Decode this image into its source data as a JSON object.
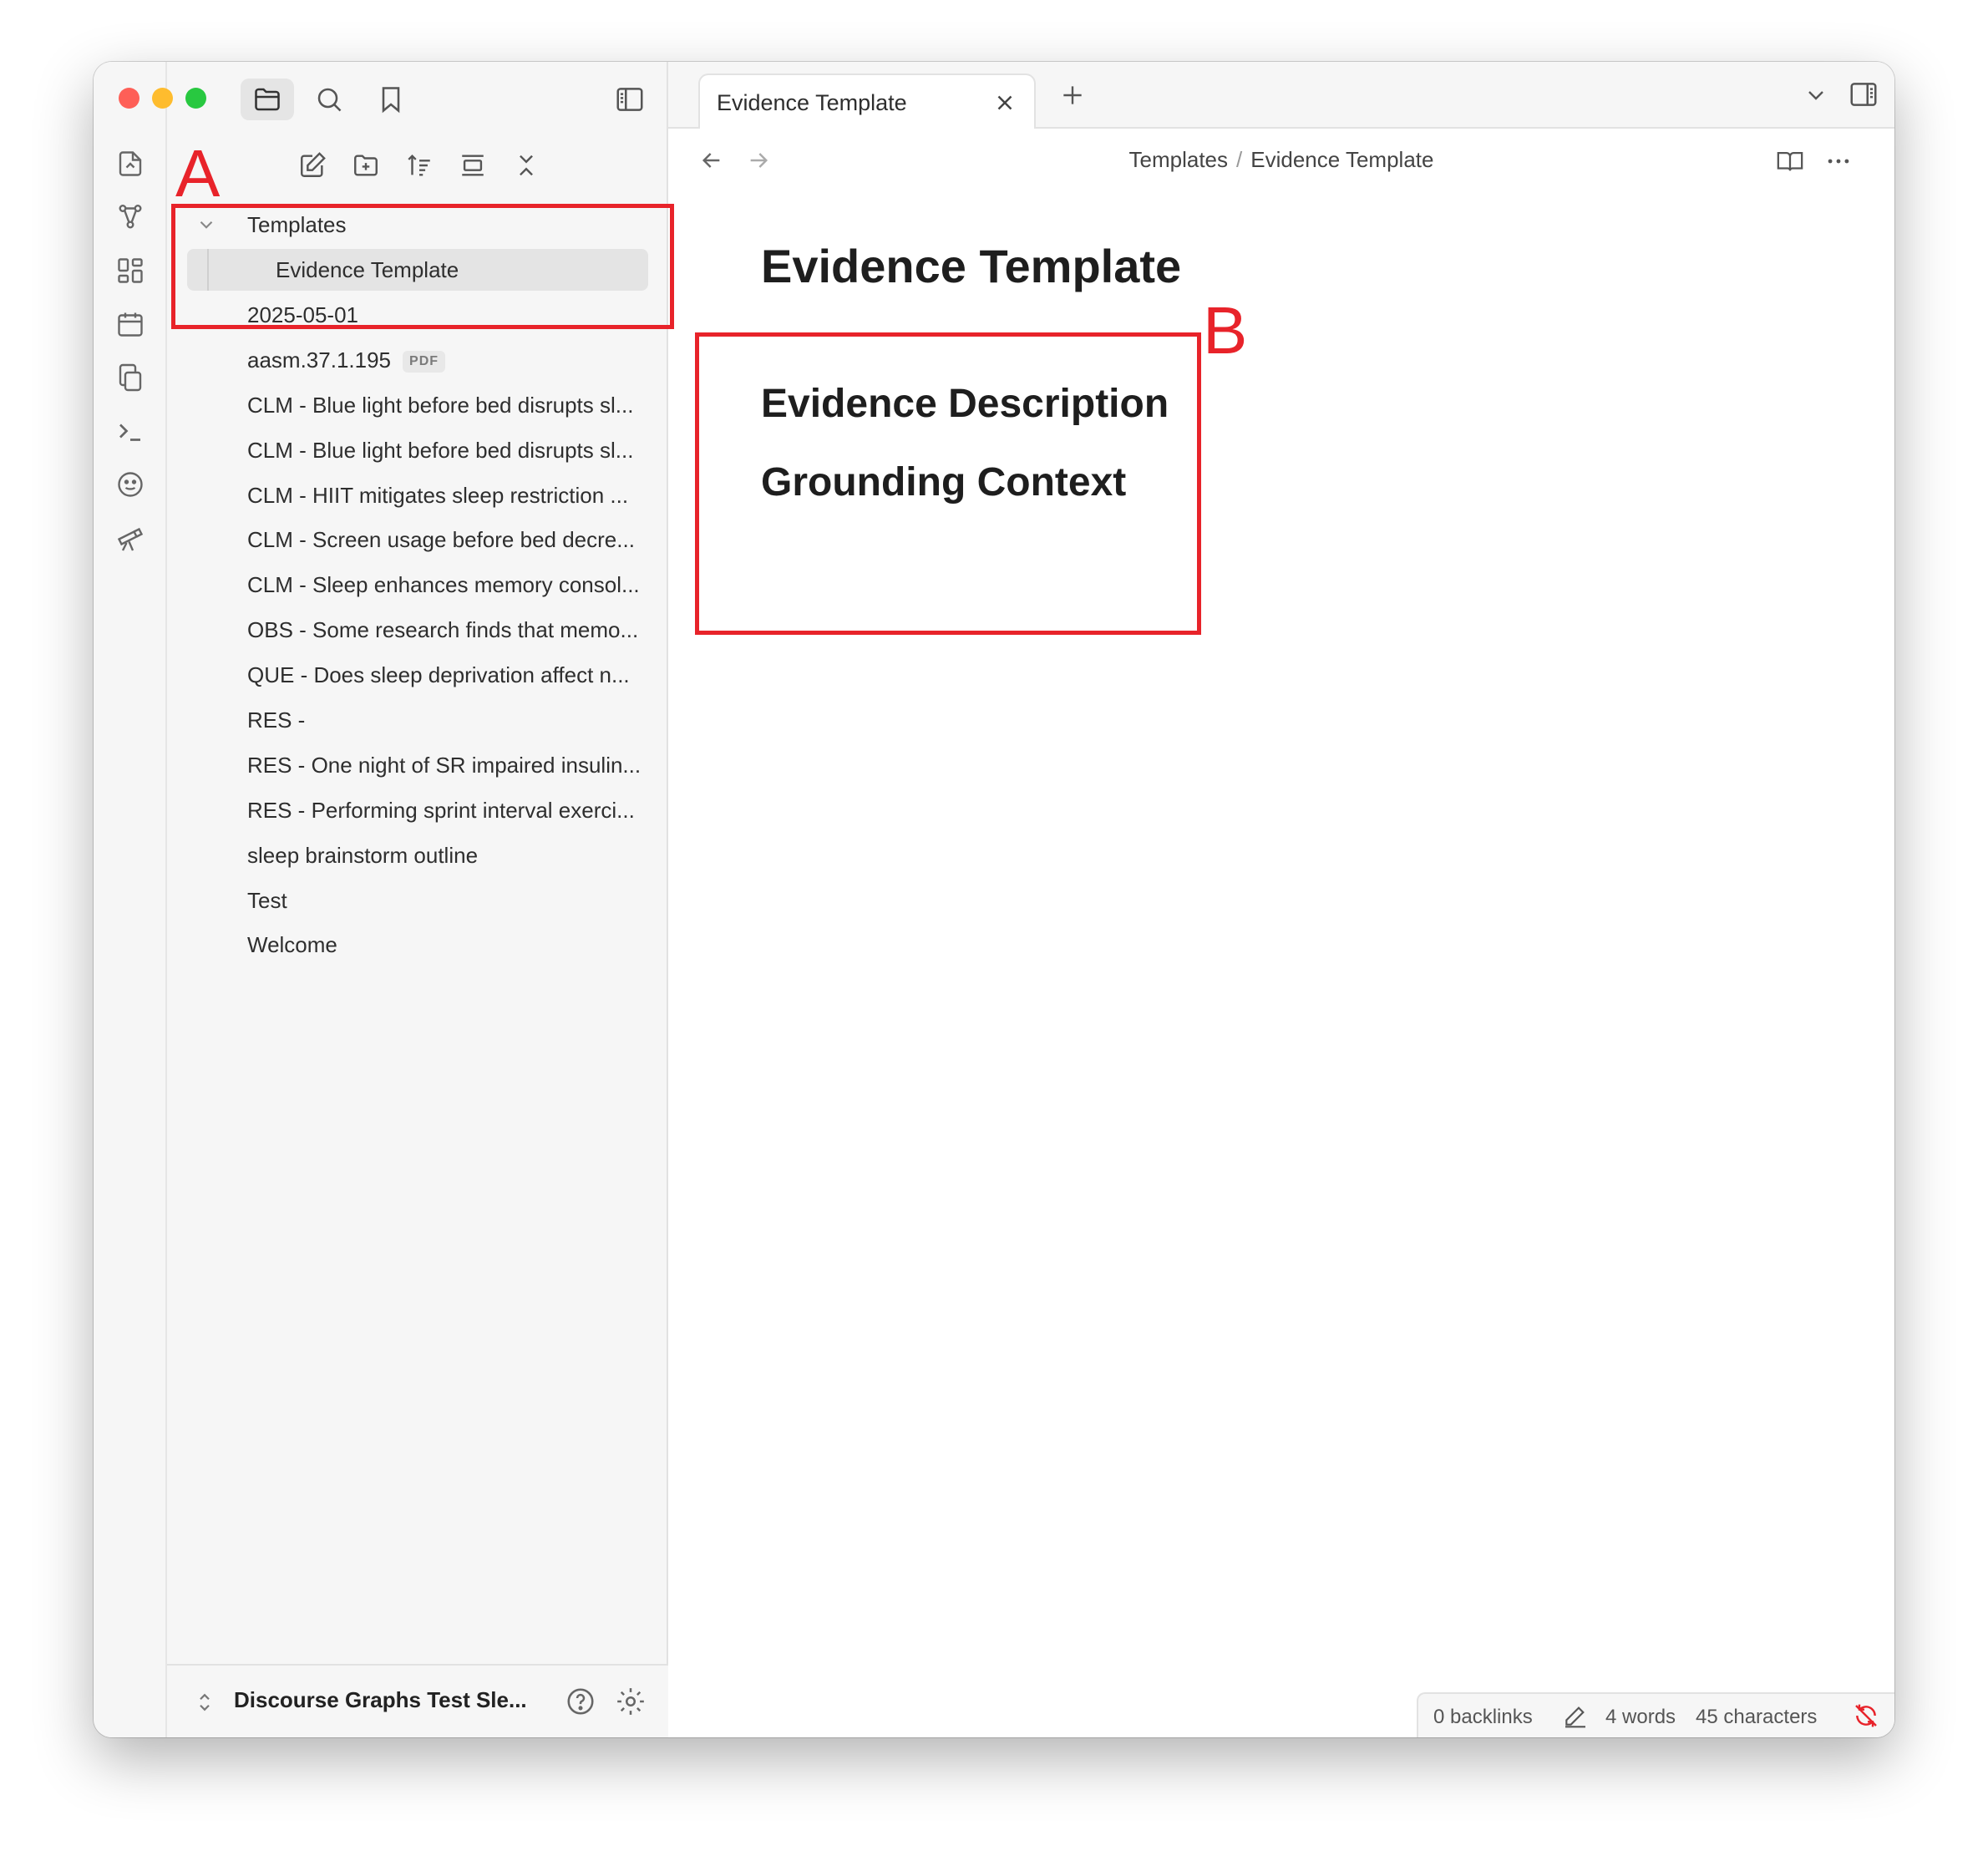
{
  "window": {
    "traffic_lights": {
      "close": "#fe5f57",
      "minimize": "#febc2e",
      "zoom": "#28c840"
    }
  },
  "ribbon": {
    "icons": [
      "switcher-icon",
      "graph-icon",
      "canvas-icon",
      "daily-note-icon",
      "templates-icon",
      "command-palette-icon",
      "face-icon",
      "telescope-icon"
    ]
  },
  "sidebar": {
    "top_icons": [
      "folder-icon",
      "search-icon",
      "bookmark-icon"
    ],
    "actions": [
      "new-note-icon",
      "new-folder-icon",
      "sort-icon",
      "collapse-icon",
      "close-icon"
    ],
    "tree": [
      {
        "label": "Templates",
        "type": "folder"
      },
      {
        "label": "Evidence Template",
        "type": "file",
        "selected": true
      },
      {
        "label": "2025-05-01",
        "type": "file"
      },
      {
        "label": "aasm.37.1.195",
        "type": "file",
        "badge": "PDF"
      },
      {
        "label": "CLM - Blue light before bed disrupts sl...",
        "type": "file"
      },
      {
        "label": "CLM - Blue light before bed disrupts sl...",
        "type": "file"
      },
      {
        "label": "CLM - HIIT mitigates sleep restriction ...",
        "type": "file"
      },
      {
        "label": "CLM - Screen usage before bed decre...",
        "type": "file"
      },
      {
        "label": "CLM - Sleep enhances memory consol...",
        "type": "file"
      },
      {
        "label": "OBS - Some research finds that memo...",
        "type": "file"
      },
      {
        "label": "QUE - Does sleep deprivation affect n...",
        "type": "file"
      },
      {
        "label": "RES -",
        "type": "file"
      },
      {
        "label": "RES - One night of SR impaired insulin...",
        "type": "file"
      },
      {
        "label": "RES - Performing sprint interval exerci...",
        "type": "file"
      },
      {
        "label": "sleep brainstorm outline",
        "type": "file"
      },
      {
        "label": "Test",
        "type": "file"
      },
      {
        "label": "Welcome",
        "type": "file"
      }
    ],
    "vault_name": "Discourse Graphs Test Sle..."
  },
  "tabs": [
    {
      "label": "Evidence Template",
      "active": true
    }
  ],
  "breadcrumb": {
    "folder": "Templates",
    "separator": "/",
    "note": "Evidence Template"
  },
  "note": {
    "title": "Evidence Template",
    "headings": [
      "Evidence Description",
      "Grounding Context"
    ]
  },
  "status": {
    "backlinks": "0 backlinks",
    "words": "4 words",
    "characters": "45 characters"
  },
  "annotations": {
    "a": "A",
    "b": "B",
    "color": "#e8232a"
  }
}
